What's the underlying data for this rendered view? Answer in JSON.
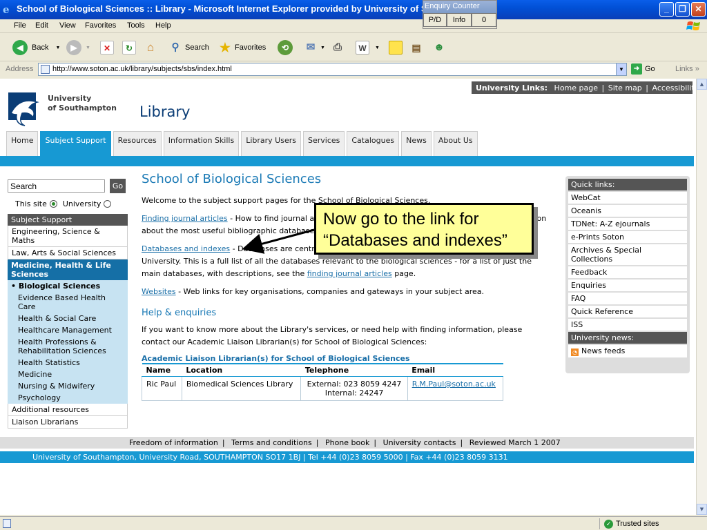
{
  "window": {
    "title": "School of Biological Sciences :: Library - Microsoft Internet Explorer provided by University of S"
  },
  "enquiry_counter": {
    "title": "Enquiry Counter",
    "pd": "P/D",
    "info": "Info",
    "count": "0"
  },
  "menu": [
    "File",
    "Edit",
    "View",
    "Favorites",
    "Tools",
    "Help"
  ],
  "toolbar": {
    "back": "Back",
    "search": "Search",
    "favorites": "Favorites"
  },
  "address": {
    "label": "Address",
    "url": "http://www.soton.ac.uk/library/subjects/sbs/index.html",
    "go": "Go",
    "links": "Links"
  },
  "page": {
    "uni_links": {
      "label": "University Links:",
      "items": [
        "Home page",
        "Site map",
        "Accessibility"
      ]
    },
    "logo_text": [
      "University",
      "of Southampton"
    ],
    "site_title": "Library",
    "tabs": [
      "Home",
      "Subject Support",
      "Resources",
      "Information Skills",
      "Library Users",
      "Services",
      "Catalogues",
      "News",
      "About Us"
    ],
    "search": {
      "placeholder": "Search",
      "go": "Go",
      "this_site": "This site",
      "university": "University"
    },
    "sidebar": {
      "header": "Subject Support",
      "items_top": [
        "Engineering, Science & Maths",
        "Law, Arts & Social Sciences"
      ],
      "section": "Medicine, Health & Life Sciences",
      "current": "Biological Sciences",
      "subitems": [
        "Evidence Based Health Care",
        "Health & Social Care",
        "Healthcare Management",
        "Health Professions & Rehabilitation Sciences",
        "Health Statistics",
        "Medicine",
        "Nursing & Midwifery",
        "Psychology"
      ],
      "items_bottom": [
        "Additional resources",
        "Liaison Librarians"
      ]
    },
    "main": {
      "heading": "School of Biological Sciences",
      "welcome": "Welcome to the subject support pages for the School of Biological Sciences.",
      "finding_link": "Finding journal articles",
      "finding_text": " - How to find journal articles and papers in your subject area, including information about the most useful bibliographic databases.",
      "databases_link": "Databases and indexes",
      "databases_text": " - Databases are central to research, including material from sources outside the University. This is a full list of all the databases relevant to the biological sciences - for a list of just the main databases, with descriptions, see the ",
      "databases_link2": "finding journal articles",
      "databases_tail": " page.",
      "websites_link": "Websites",
      "websites_text": " - Web links for key organisations, companies and gateways in your subject area.",
      "help_heading": "Help & enquiries",
      "help_text": "If you want to know more about the Library's services, or need help with finding information, please contact our Academic Liaison Librarian(s) for School of Biological Sciences:",
      "table_caption": "Academic Liaison Librarian(s) for School of Biological Sciences",
      "table_headers": [
        "Name",
        "Location",
        "Telephone",
        "Email"
      ],
      "table_row": {
        "name": "Ric Paul",
        "location": "Biomedical Sciences Library",
        "phone_ext": "External: 023 8059 4247",
        "phone_int": "Internal: 24247",
        "email": "R.M.Paul@soton.ac.uk"
      }
    },
    "quick_links": {
      "header": "Quick links:",
      "items": [
        "WebCat",
        "Oceanis",
        "TDNet: A-Z ejournals",
        "e-Prints Soton",
        "Archives & Special Collections",
        "Feedback",
        "Enquiries",
        "FAQ",
        "Quick Reference",
        "ISS"
      ],
      "news_header": "University news:",
      "news_item": "News feeds"
    },
    "footer_links": [
      "Freedom of information",
      "Terms and conditions",
      "Phone book",
      "University contacts",
      "Reviewed March 1 2007"
    ],
    "footer_address": "University of Southampton, University Road, SOUTHAMPTON SO17 1BJ  |  Tel +44 (0)23 8059 5000  |  Fax +44 (0)23 8059 3131"
  },
  "callout": {
    "line1": "Now go to the link for",
    "line2": "“Databases and indexes”"
  },
  "status": {
    "zone": "Trusted sites"
  }
}
